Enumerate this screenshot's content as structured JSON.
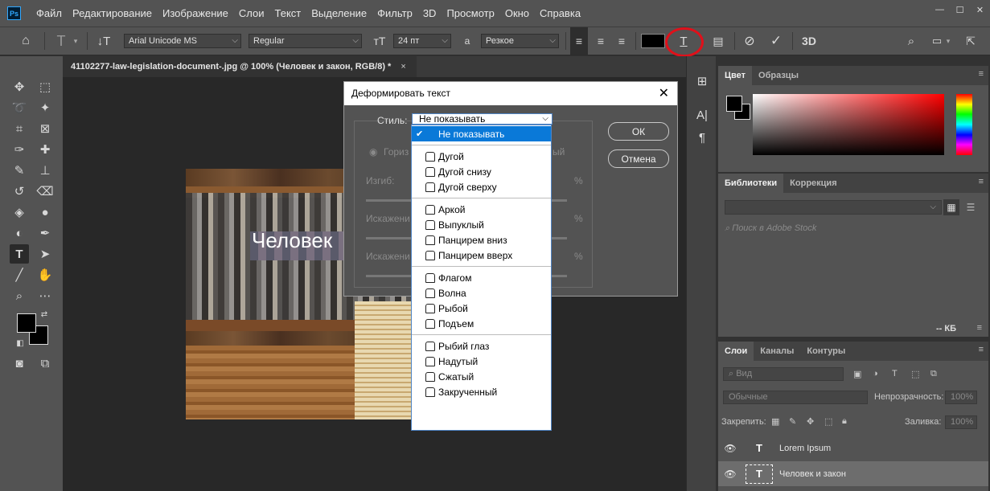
{
  "app": {
    "logo": "Ps",
    "window_title": "41102277-law-legislation-document-.jpg @ 100% (Человек и закон, RGB/8) *"
  },
  "menu": [
    "Файл",
    "Редактирование",
    "Изображение",
    "Слои",
    "Текст",
    "Выделение",
    "Фильтр",
    "3D",
    "Просмотр",
    "Окно",
    "Справка"
  ],
  "options_bar": {
    "font_family": "Arial Unicode MS",
    "font_style": "Regular",
    "font_size": "24 пт",
    "aa_label": "a",
    "antialias": "Резкое",
    "three_d": "3D",
    "text_color": "#000000"
  },
  "document_tab": {
    "label": "41102277-law-legislation-document-.jpg @ 100% (Человек и закон, RGB/8) *",
    "close": "×"
  },
  "canvas": {
    "text_layer": "Человек"
  },
  "dialog": {
    "title": "Деформировать текст",
    "style_label": "Стиль:",
    "style_value": "Не показывать",
    "orientation_h": "Гориз",
    "orientation_v_tail": "ый",
    "bend_label": "Изгиб:",
    "hdist_label": "Искажени",
    "vdist_label": "Искажени",
    "percent": "%",
    "ok": "ОК",
    "cancel": "Отмена"
  },
  "dropdown_items": [
    {
      "label": "Не показывать",
      "selected": true,
      "group": 0
    },
    {
      "label": "Дугой",
      "group": 1
    },
    {
      "label": "Дугой снизу",
      "group": 1
    },
    {
      "label": "Дугой сверху",
      "group": 1
    },
    {
      "label": "Аркой",
      "group": 2
    },
    {
      "label": "Выпуклый",
      "group": 2
    },
    {
      "label": "Панцирем вниз",
      "group": 2
    },
    {
      "label": "Панцирем вверх",
      "group": 2
    },
    {
      "label": "Флагом",
      "group": 3
    },
    {
      "label": "Волна",
      "group": 3
    },
    {
      "label": "Рыбой",
      "group": 3
    },
    {
      "label": "Подъем",
      "group": 3
    },
    {
      "label": "Рыбий глаз",
      "group": 4
    },
    {
      "label": "Надутый",
      "group": 4
    },
    {
      "label": "Сжатый",
      "group": 4
    },
    {
      "label": "Закрученный",
      "group": 4
    }
  ],
  "panels": {
    "color_tabs": [
      "Цвет",
      "Образцы"
    ],
    "library_tabs": [
      "Библиотеки",
      "Коррекция"
    ],
    "library_search_placeholder": "Поиск в Adobe Stock",
    "library_size": "-- КБ",
    "layers_tabs": [
      "Слои",
      "Каналы",
      "Контуры"
    ],
    "layers_search": "Вид",
    "blend_mode": "Обычные",
    "opacity_label": "Непрозрачность:",
    "opacity_value": "100%",
    "lock_label": "Закрепить:",
    "fill_label": "Заливка:",
    "fill_value": "100%",
    "layers": [
      {
        "name": "Lorem Ipsum",
        "selected": false
      },
      {
        "name": "Человек и закон",
        "selected": true
      }
    ]
  },
  "colors": {
    "ui_bg": "#535353",
    "canvas_bg": "#282828",
    "highlight": "#e0101a",
    "selection_blue": "#0a79d8"
  }
}
